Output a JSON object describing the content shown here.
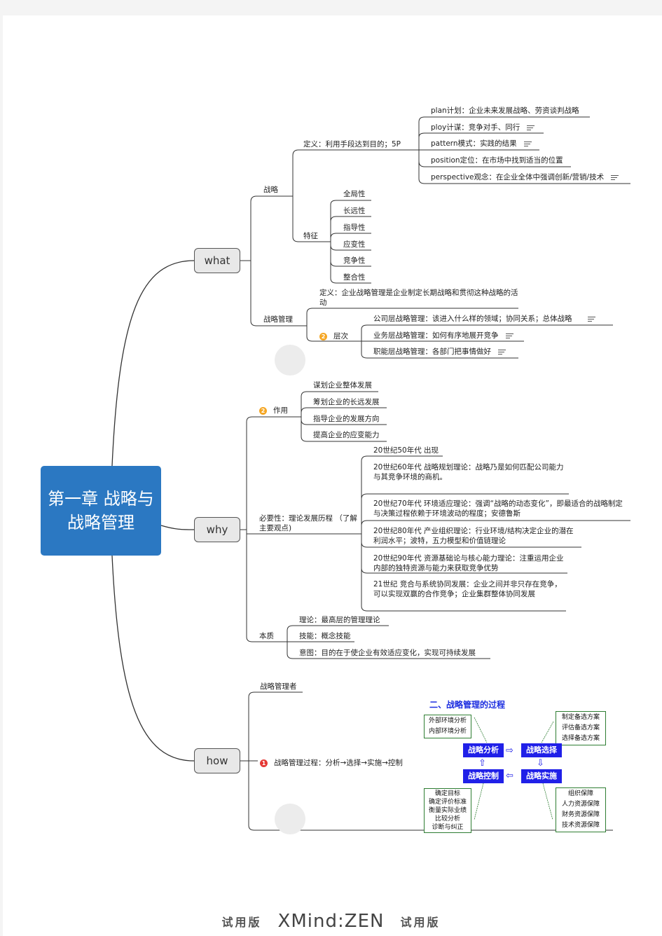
{
  "root": {
    "title": "第一章 战略与战略管理"
  },
  "main_topics": [
    {
      "label": "what"
    },
    {
      "label": "why"
    },
    {
      "label": "how"
    }
  ],
  "what": {
    "strategy": {
      "label": "战略",
      "definition": {
        "label": "定义：利用手段达到目的；5P",
        "items": [
          {
            "text": "plan计划：企业未来发展战略、劳资谈判战略",
            "has_note": false
          },
          {
            "text": "ploy计谋：竞争对手、同行",
            "has_note": true
          },
          {
            "text": "pattern模式：实践的结果",
            "has_note": true
          },
          {
            "text": "position定位：在市场中找到适当的位置",
            "has_note": false
          },
          {
            "text": "perspective观念：在企业全体中强调创新/营销/技术",
            "has_note": true
          }
        ]
      },
      "features": {
        "label": "特征",
        "items": [
          "全局性",
          "长远性",
          "指导性",
          "应变性",
          "竞争性",
          "整合性"
        ]
      }
    },
    "management": {
      "label": "战略管理",
      "definition": "定义：企业战略管理是企业制定长期战略和贯彻这种战略的活动",
      "levels": {
        "label": "层次",
        "badge": "2",
        "items": [
          {
            "text": "公司层战略管理：该进入什么样的领域；协同关系；总体战略",
            "has_note": true
          },
          {
            "text": "业务层战略管理：如何有序地展开竞争",
            "has_note": true
          },
          {
            "text": "职能层战略管理：各部门把事情做好",
            "has_note": true
          }
        ]
      }
    }
  },
  "why": {
    "role": {
      "label": "作用",
      "badge": "2",
      "items": [
        "谋划企业整体发展",
        "筹划企业的长远发展",
        "指导企业的发展方向",
        "提高企业的应变能力"
      ]
    },
    "necessity": {
      "label": "必要性：理论发展历程 （了解主要观点)",
      "items": [
        "20世纪50年代 出现",
        "20世纪60年代 战略规划理论：战略乃是如何匹配公司能力与其竞争环境的商机。",
        "20世纪70年代 环境适应理论：强调“战略的动态变化”，即最适合的战略制定与决策过程依赖于环境波动的程度；安德鲁斯",
        "20世纪80年代 产业组织理论：行业环境/结构决定企业的潜在利润水平；波特，五力模型和价值链理论",
        "20世纪90年代 资源基础论与核心能力理论：注重运用企业内部的独特资源与能力来获取竞争优势",
        "21世纪 竞合与系统协同发展：企业之间并非只存在竞争，可以实现双赢的合作竞争；企业集群整体协同发展"
      ]
    },
    "essence": {
      "label": "本质",
      "items": [
        "理论：最高层的管理理论",
        "技能：概念技能",
        "意图：目的在于使企业有效适应变化，实现可持续发展"
      ]
    }
  },
  "how": {
    "managers": "战略管理者",
    "process": {
      "label": "战略管理过程：分析→选择→实施→控制",
      "badge": "1",
      "image": {
        "title": "二、战略管理的过程",
        "analysis": "战略分析",
        "choice": "战略选择",
        "implement": "战略实施",
        "control": "战略控制",
        "analysis_notes": [
          "外部环境分析",
          "内部环境分析"
        ],
        "choice_notes": [
          "制定备选方案",
          "评估备选方案",
          "选择备选方案"
        ],
        "control_notes": [
          "确定目标",
          "确定评价标准",
          "衡量实际业绩",
          "比较分析",
          "诊断与纠正"
        ],
        "implement_notes": [
          "组织保障",
          "人力资源保障",
          "财务资源保障",
          "技术资源保障"
        ]
      }
    }
  },
  "watermark": {
    "trial": "试用版",
    "brand": "XMind:ZEN"
  }
}
